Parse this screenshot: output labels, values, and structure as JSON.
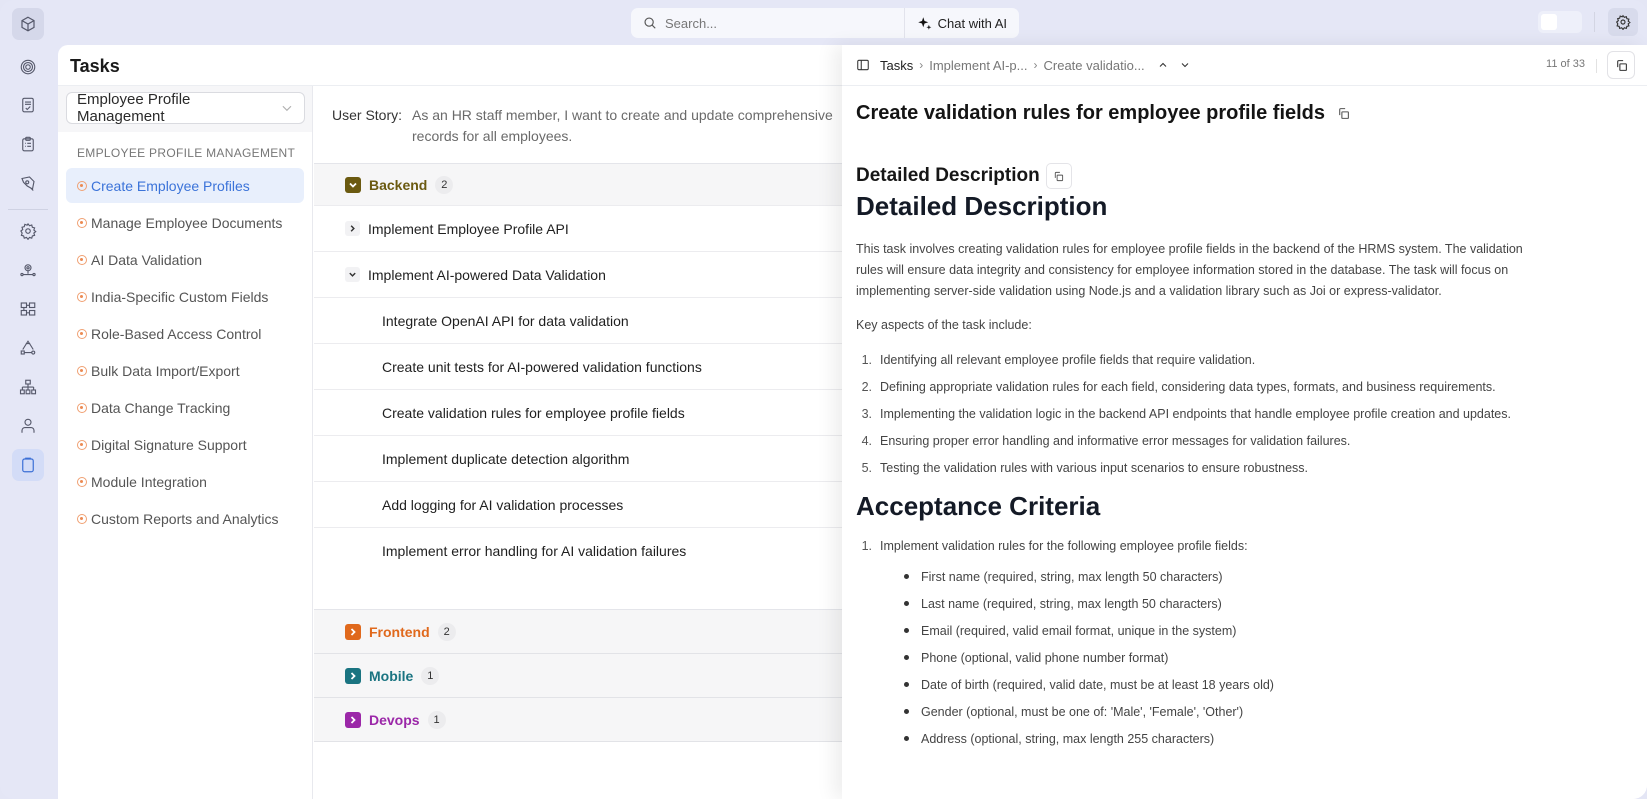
{
  "topbar": {
    "search_placeholder": "Search...",
    "chat_label": "Chat with AI"
  },
  "rail": {
    "icons": [
      "cube-icon",
      "target-icon",
      "checklist-doc-icon",
      "clipboard-list-icon",
      "pen-tool-icon",
      "gear-icon",
      "gear-network-icon",
      "workflow-icon",
      "triangle-nodes-icon",
      "org-chart-icon",
      "user-icon",
      "clipboard-icon"
    ],
    "active": "clipboard-icon"
  },
  "page": {
    "title": "Tasks"
  },
  "left_panel": {
    "dropdown_value": "Employee Profile Management",
    "section_label": "EMPLOYEE PROFILE MANAGEMENT",
    "stories": [
      {
        "label": "Create Employee Profiles",
        "active": true
      },
      {
        "label": "Manage Employee Documents"
      },
      {
        "label": "AI Data Validation"
      },
      {
        "label": "India-Specific Custom Fields"
      },
      {
        "label": "Role-Based Access Control"
      },
      {
        "label": "Bulk Data Import/Export"
      },
      {
        "label": "Data Change Tracking"
      },
      {
        "label": "Digital Signature Support"
      },
      {
        "label": "Module Integration"
      },
      {
        "label": "Custom Reports and Analytics"
      }
    ]
  },
  "middle": {
    "user_story_label": "User Story:",
    "user_story_text": "As an HR staff member, I want to create and update comprehensive records for all employees.",
    "groups": [
      {
        "name": "Backend",
        "count": "2",
        "color": "#6b5a10",
        "expanded": true
      },
      {
        "name": "Frontend",
        "count": "2",
        "color": "#e0691d"
      },
      {
        "name": "Mobile",
        "count": "1",
        "color": "#1a7481"
      },
      {
        "name": "Devops",
        "count": "1",
        "color": "#9b27a8"
      }
    ],
    "backend_tasks": [
      {
        "label": "Implement Employee Profile API",
        "expanded": false
      },
      {
        "label": "Implement AI-powered Data Validation",
        "expanded": true
      }
    ],
    "subtasks": [
      "Integrate OpenAI API for data validation",
      "Create unit tests for AI-powered validation functions",
      "Create validation rules for employee profile fields",
      "Implement duplicate detection algorithm",
      "Add logging for AI validation processes",
      "Implement error handling for AI validation failures"
    ]
  },
  "drawer": {
    "breadcrumb": [
      "Tasks",
      "Implement AI-p...",
      "Create validatio..."
    ],
    "counter": "11 of 33",
    "title": "Create validation rules for employee profile fields",
    "section_heading": "Detailed Description",
    "h1_description": "Detailed Description",
    "description": "This task involves creating validation rules for employee profile fields in the backend of the HRMS system. The validation rules will ensure data integrity and consistency for employee information stored in the database. The task will focus on implementing server-side validation using Node.js and a validation library such as Joi or express-validator.",
    "key_aspects_intro": "Key aspects of the task include:",
    "key_aspects": [
      "Identifying all relevant employee profile fields that require validation.",
      "Defining appropriate validation rules for each field, considering data types, formats, and business requirements.",
      "Implementing the validation logic in the backend API endpoints that handle employee profile creation and updates.",
      "Ensuring proper error handling and informative error messages for validation failures.",
      "Testing the validation rules with various input scenarios to ensure robustness."
    ],
    "h1_acceptance": "Acceptance Criteria",
    "acceptance_item": "Implement validation rules for the following employee profile fields:",
    "fields": [
      "First name (required, string, max length 50 characters)",
      "Last name (required, string, max length 50 characters)",
      "Email (required, valid email format, unique in the system)",
      "Phone (optional, valid phone number format)",
      "Date of birth (required, valid date, must be at least 18 years old)",
      "Gender (optional, must be one of: 'Male', 'Female', 'Other')",
      "Address (optional, string, max length 255 characters)"
    ]
  }
}
